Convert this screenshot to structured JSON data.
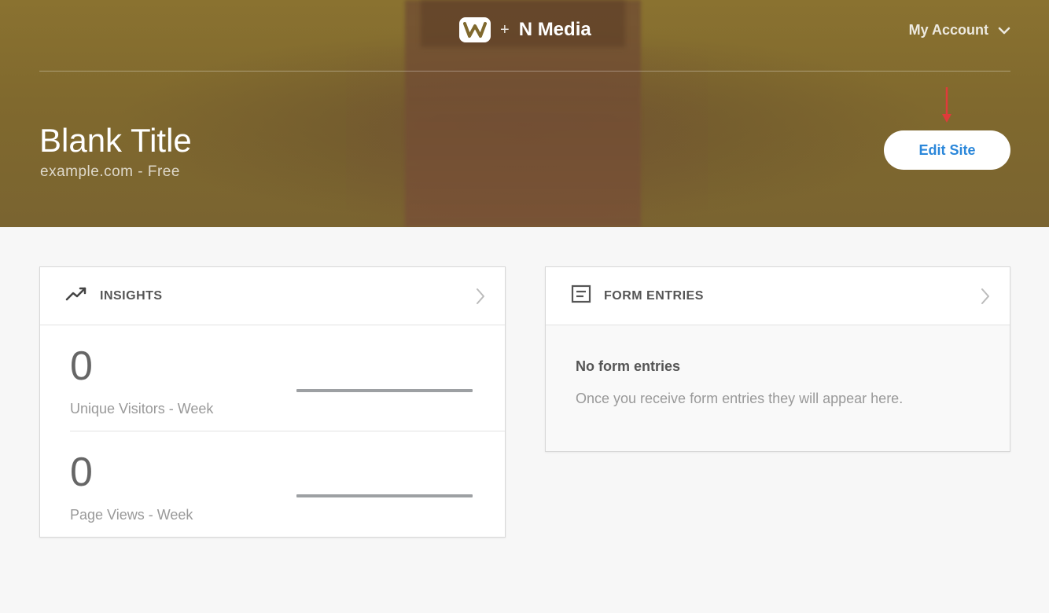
{
  "brand": {
    "logo_icon": "weebly-w-icon",
    "plus": "+",
    "name": "N Media"
  },
  "account": {
    "label": "My Account",
    "icon": "chevron-down-icon"
  },
  "site": {
    "title": "Blank Title",
    "subtitle": "example.com - Free"
  },
  "edit_button": {
    "label": "Edit Site"
  },
  "insights": {
    "title": "INSIGHTS",
    "icon": "trending-up-icon",
    "stats": [
      {
        "value": "0",
        "label": "Unique Visitors - Week"
      },
      {
        "value": "0",
        "label": "Page Views - Week"
      }
    ]
  },
  "form_entries": {
    "title": "FORM ENTRIES",
    "icon": "form-icon",
    "empty_title": "No form entries",
    "empty_desc": "Once you receive form entries they will appear here."
  },
  "colors": {
    "accent": "#2b87da",
    "hero": "#80692e",
    "arrow": "#e03a3a",
    "background": "#f7f7f7"
  }
}
